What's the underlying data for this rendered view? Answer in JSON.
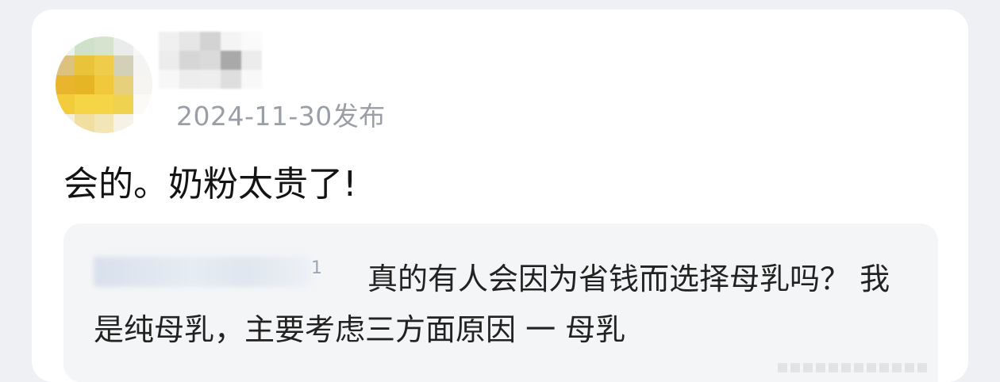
{
  "post": {
    "date": "2024-11-30发布",
    "content": "会的。奶粉太贵了!",
    "author_avatar": "blurred-avatar",
    "author_name": ""
  },
  "quote": {
    "author_tail": "1",
    "text": "真的有人会因为省钱而选择母乳吗？ 我是纯母乳，主要考虑三方面原因 一 母乳"
  },
  "colors": {
    "page_bg": "#eef0f3",
    "card_bg": "#ffffff",
    "quote_bg": "#f4f5f7",
    "date_text": "#9a9ea6"
  }
}
